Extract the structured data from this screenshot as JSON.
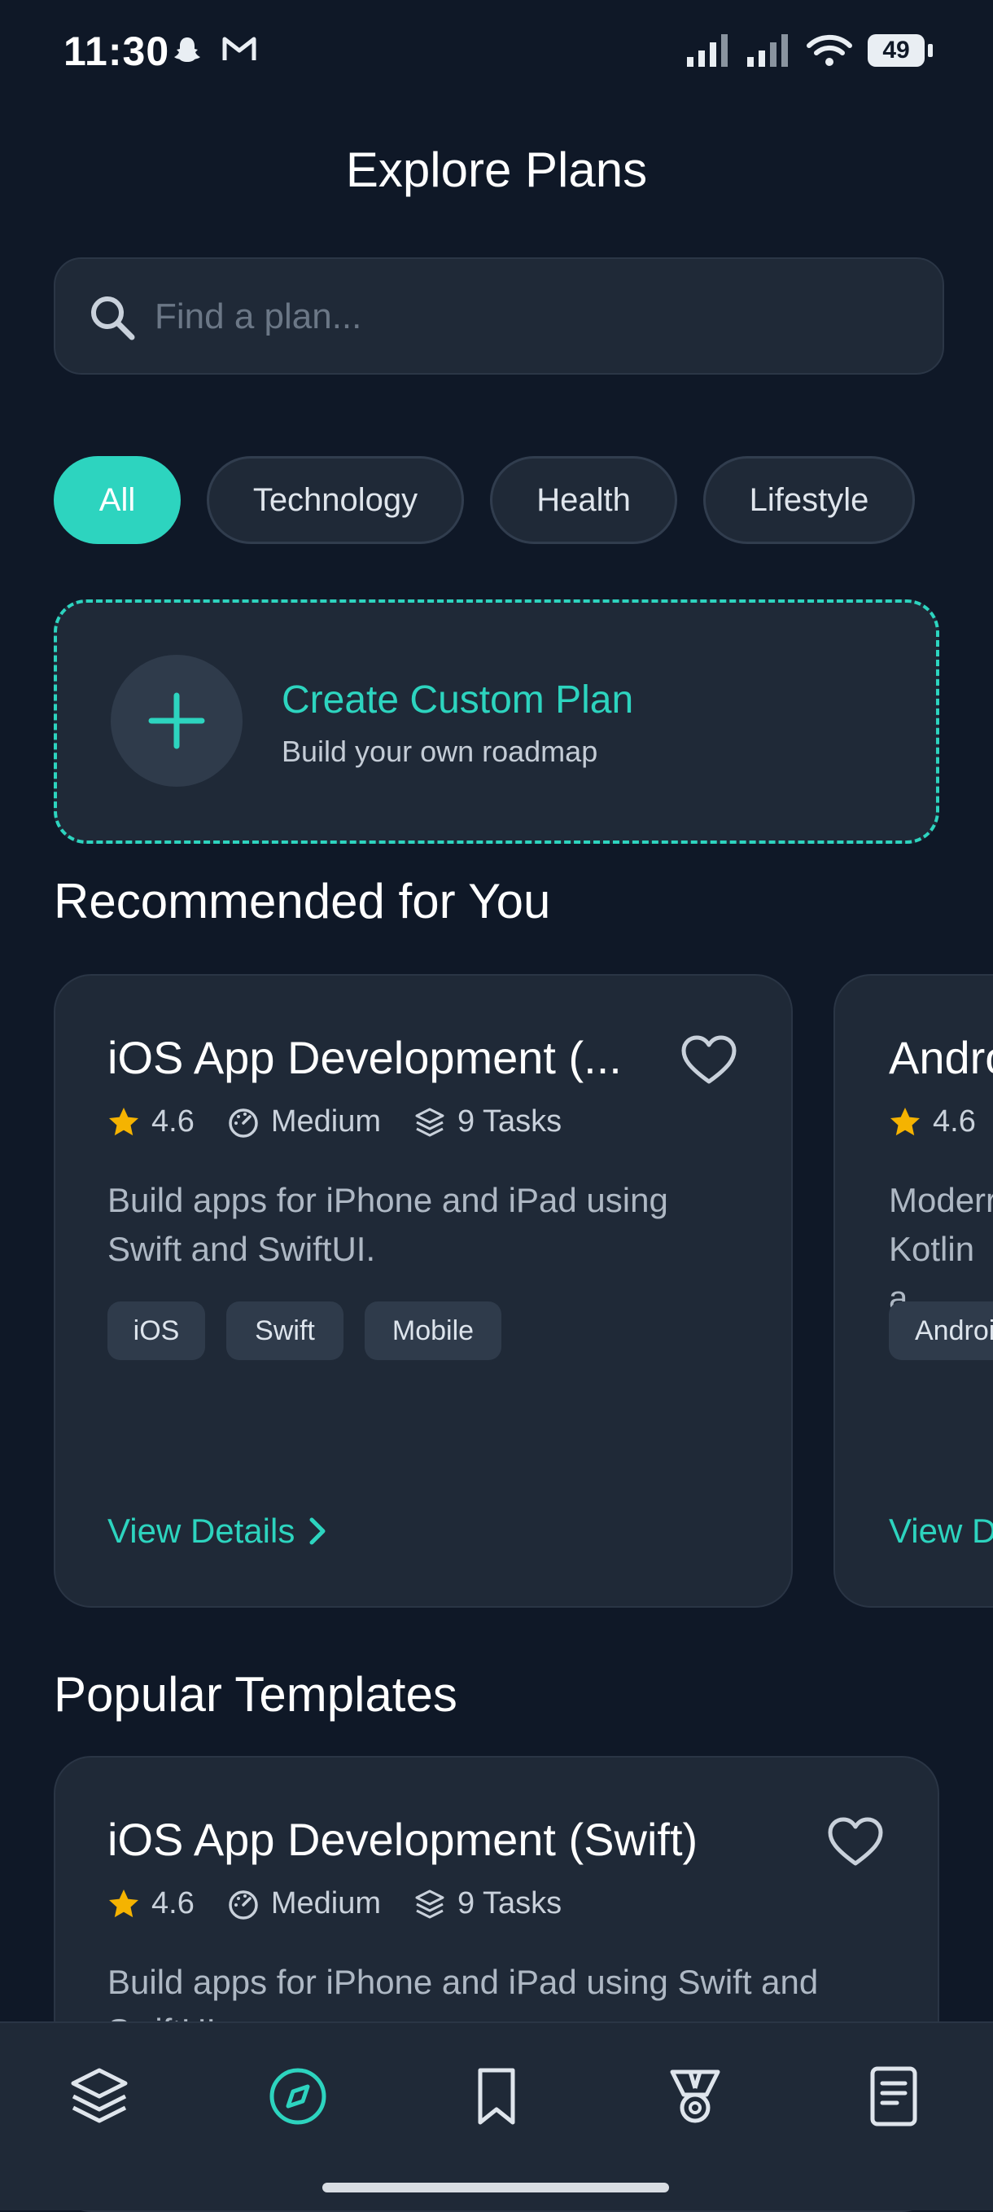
{
  "status_bar": {
    "time": "11:30",
    "battery": "49"
  },
  "header": {
    "title": "Explore Plans"
  },
  "search": {
    "placeholder": "Find a plan..."
  },
  "filters": [
    {
      "label": "All",
      "active": true
    },
    {
      "label": "Technology",
      "active": false
    },
    {
      "label": "Health",
      "active": false
    },
    {
      "label": "Lifestyle",
      "active": false
    }
  ],
  "custom_plan": {
    "title": "Create Custom Plan",
    "subtitle": "Build your own roadmap"
  },
  "recommended": {
    "title": "Recommended for You",
    "cards": [
      {
        "title": "iOS App Development (...",
        "rating": "4.6",
        "difficulty": "Medium",
        "tasks": "9 Tasks",
        "description_line1": "Build apps for iPhone and iPad using",
        "description_line2": "Swift and SwiftUI.",
        "tags": [
          "iOS",
          "Swift",
          "Mobile"
        ],
        "cta": "View Details"
      },
      {
        "title": "Andro",
        "rating": "4.6",
        "description_line1": "Moderr",
        "description_line2": "Kotlin a",
        "tags": [
          "Androi"
        ],
        "cta": "View D"
      }
    ]
  },
  "popular": {
    "title": "Popular Templates",
    "card": {
      "title": "iOS App Development (Swift)",
      "rating": "4.6",
      "difficulty": "Medium",
      "tasks": "9 Tasks",
      "description_line1": "Build apps for iPhone and iPad using Swift and",
      "description_line2": "SwiftUI."
    }
  },
  "bottom_nav": [
    {
      "name": "layers-icon",
      "active": false
    },
    {
      "name": "compass-icon",
      "active": true
    },
    {
      "name": "bookmark-icon",
      "active": false
    },
    {
      "name": "medal-icon",
      "active": false
    },
    {
      "name": "document-icon",
      "active": false
    }
  ],
  "colors": {
    "accent": "#2dd4bf",
    "background": "#0f1827",
    "card": "#1f2937",
    "star": "#f5b301"
  }
}
